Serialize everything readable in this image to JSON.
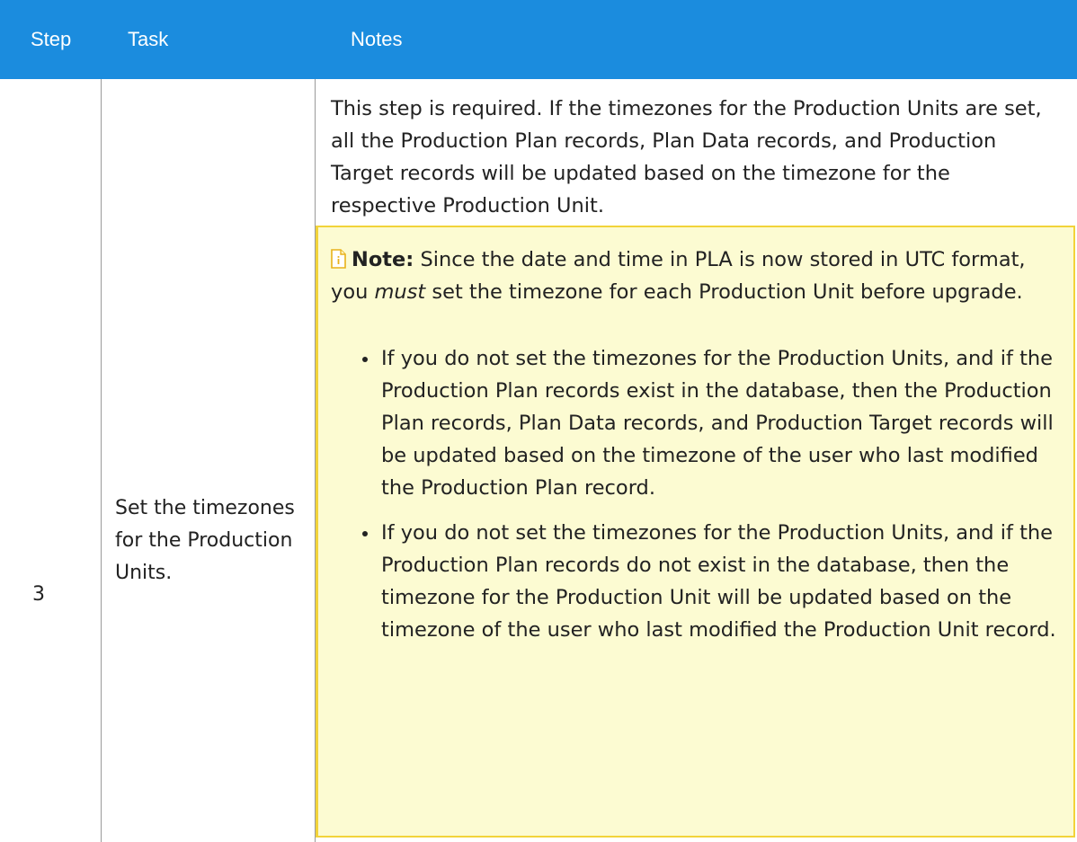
{
  "table": {
    "headers": [
      "Step",
      "Task",
      "Notes"
    ],
    "row": {
      "step": "3",
      "task": "Set the timezones for the Production Units.",
      "notes_intro": "This step is required. If the timezones for the Production Units are set, all the Production Plan records, Plan Data records, and Production Target records will be updated based on the timezone for the respective Production Unit.",
      "note": {
        "icon": "note-document-icon",
        "label": "Note:",
        "text_before": " Since the date and time in PLA is now stored in UTC format, you ",
        "emphasis": "must",
        "text_after": " set the timezone for each Production Unit before upgrade.",
        "bullets": [
          "If you do not set the timezones for the Production Units, and if the Production Plan records exist in the database, then the Production Plan records, Plan Data records, and Production Target records will be updated based on the timezone of the user who last modified the Production Plan record.",
          "If you do not set the timezones for the Production Units, and if the Production Plan records do not exist in the database, then the timezone for the Production Unit will be updated based on the timezone of the user who last modified the Production Unit record."
        ]
      }
    }
  },
  "colors": {
    "header_bg": "#1b8cde",
    "header_text": "#ffffff",
    "note_bg": "#fcfbd2",
    "note_border": "#f2d33a",
    "grid_line": "#9a9a9a"
  }
}
